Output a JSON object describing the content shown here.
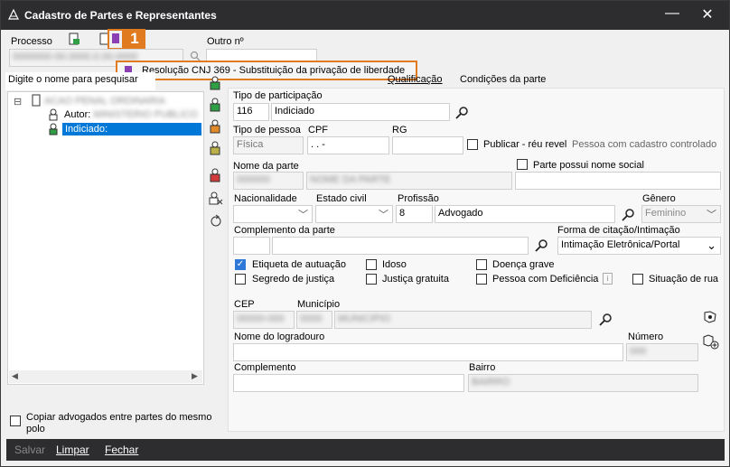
{
  "window": {
    "title": "Cadastro de Partes e Representantes"
  },
  "top": {
    "processo_label": "Processo",
    "processo_value": "0000000-00.0000.0.00.0000",
    "outro_label": "Outro nº",
    "badge": "1"
  },
  "tooltip": {
    "text": "Resolução CNJ 369 - Substituição da privação de liberdade"
  },
  "left": {
    "search_placeholder": "Digite o nome para pesquisar",
    "tree_root": "ACAO PENAL ORDINARIA",
    "autor_label": "Autor:",
    "autor_value": "MINISTERIO PUBLICO",
    "indiciado_label": "Indiciado:",
    "copiar_label": "Copiar advogados entre partes do mesmo polo"
  },
  "tabs": {
    "tab1": "Qualificação",
    "tab2": "Condições da parte"
  },
  "form": {
    "tipo_participacao_label": "Tipo de participação",
    "tipo_participacao_code": "116",
    "tipo_participacao_value": "Indiciado",
    "tipo_pessoa_label": "Tipo de pessoa",
    "tipo_pessoa_value": "Física",
    "cpf_label": "CPF",
    "cpf_value": ".   .   -",
    "rg_label": "RG",
    "publicar_label": "Publicar - réu revel",
    "controlado_label": "Pessoa com cadastro controlado",
    "nome_parte_label": "Nome da parte",
    "nome_parte_code": "000000",
    "nome_parte_value": "NOME DA PARTE",
    "nome_social_label": "Parte possui nome social",
    "nacionalidade_label": "Nacionalidade",
    "estado_civil_label": "Estado civil",
    "profissao_label": "Profissão",
    "profissao_code": "8",
    "profissao_value": "Advogado",
    "genero_label": "Gênero",
    "genero_value": "Feminino",
    "complemento_parte_label": "Complemento da parte",
    "forma_citacao_label": "Forma de citação/Intimação",
    "forma_citacao_value": "Intimação Eletrônica/Portal",
    "checks": {
      "etiqueta": "Etiqueta de autuação",
      "idoso": "Idoso",
      "doenca": "Doença grave",
      "segredo": "Segredo de justiça",
      "justica_gratuita": "Justiça gratuita",
      "deficiencia": "Pessoa com Deficiência",
      "situacao_rua": "Situação de rua"
    },
    "cep_label": "CEP",
    "cep_value": "00000-000",
    "municipio_label": "Município",
    "municipio_code": "0000",
    "municipio_value": "MUNICIPIO",
    "logradouro_label": "Nome do logradouro",
    "numero_label": "Número",
    "numero_value": "000",
    "complemento_label": "Complemento",
    "bairro_label": "Bairro",
    "bairro_value": "BAIRRO"
  },
  "footer": {
    "salvar": "Salvar",
    "limpar": "Limpar",
    "fechar": "Fechar"
  },
  "colors": {
    "accent": "#0078d7",
    "highlight": "#e07b1f",
    "titlebar": "#2d2d30"
  }
}
